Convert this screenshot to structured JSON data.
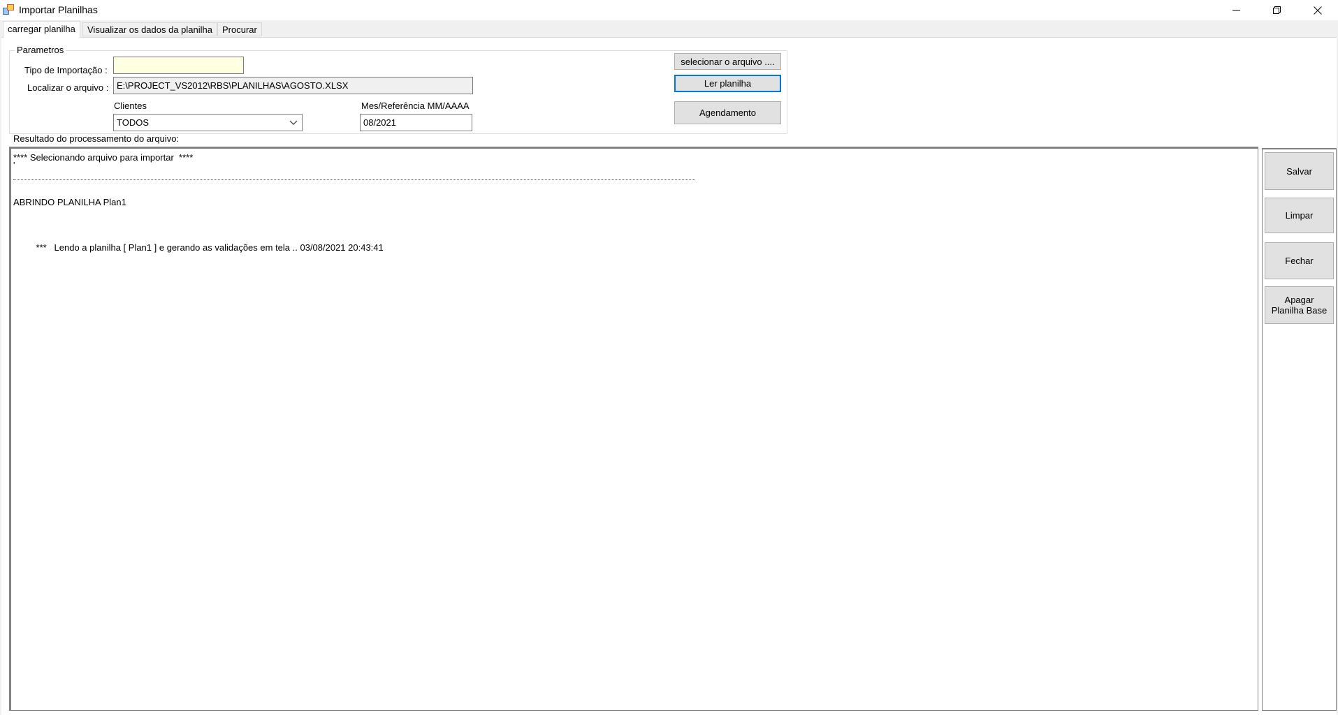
{
  "window": {
    "title": "Importar Planilhas",
    "controls": [
      "minimize-icon",
      "restore-icon",
      "close-icon"
    ]
  },
  "tabs": [
    {
      "label": "carregar planilha",
      "active": true
    },
    {
      "label": "Visualizar os dados da planilha",
      "active": false
    },
    {
      "label": "Procurar",
      "active": false
    }
  ],
  "parametros": {
    "legend": "Parametros",
    "tipo_label": "Tipo de Importação :",
    "tipo_value": "",
    "arquivo_label": "Localizar o arquivo :",
    "arquivo_value": "E:\\PROJECT_VS2012\\RBS\\PLANILHAS\\AGOSTO.XLSX",
    "clientes_label": "Clientes",
    "clientes_value": "TODOS",
    "mes_label": "Mes/Referência MM/AAAA",
    "mes_value": "08/2021",
    "btn_selecionar": "selecionar o arquivo ....",
    "btn_ler": "Ler planilha",
    "btn_agendamento": "Agendamento"
  },
  "resultado": {
    "label": "Resultado do processamento do arquivo:",
    "lines": [
      "**** Selecionando arquivo para importar  ****",
      "'",
      "ABRINDO PLANILHA Plan1",
      "         ***   Lendo a planilha [ Plan1 ] e gerando as validações em tela .. 03/08/2021 20:43:41"
    ]
  },
  "side_buttons": {
    "salvar": "Salvar",
    "limpar": "Limpar",
    "fechar": "Fechar",
    "apagar": "Apagar Planilha Base"
  },
  "colors": {
    "accent": "#0078d7",
    "input_highlight": "#ffffe1",
    "button_face": "#e1e1e1"
  }
}
